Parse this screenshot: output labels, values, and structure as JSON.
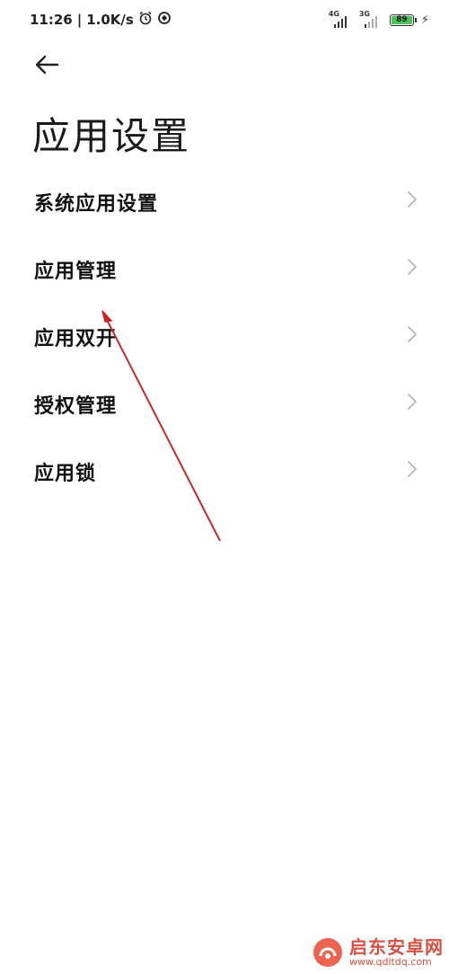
{
  "status_bar": {
    "time": "11:26",
    "separator": "|",
    "net_speed": "1.0K/s",
    "signal1_label": "4G",
    "signal2_label": "3G",
    "battery": "89",
    "alarm_icon": "alarm-icon",
    "vpn_icon": "data-saver-icon"
  },
  "header": {
    "back_icon": "arrow-left-icon",
    "title": "应用设置"
  },
  "list": {
    "items": [
      {
        "label": "系统应用设置"
      },
      {
        "label": "应用管理"
      },
      {
        "label": "应用双开"
      },
      {
        "label": "授权管理"
      },
      {
        "label": "应用锁"
      }
    ]
  },
  "watermark": {
    "title": "启东安卓网",
    "url": "www.qdltdq.com"
  },
  "colors": {
    "annotation_arrow": "#c62828",
    "battery_fill": "#49c25a",
    "watermark": "#d43b2c"
  }
}
